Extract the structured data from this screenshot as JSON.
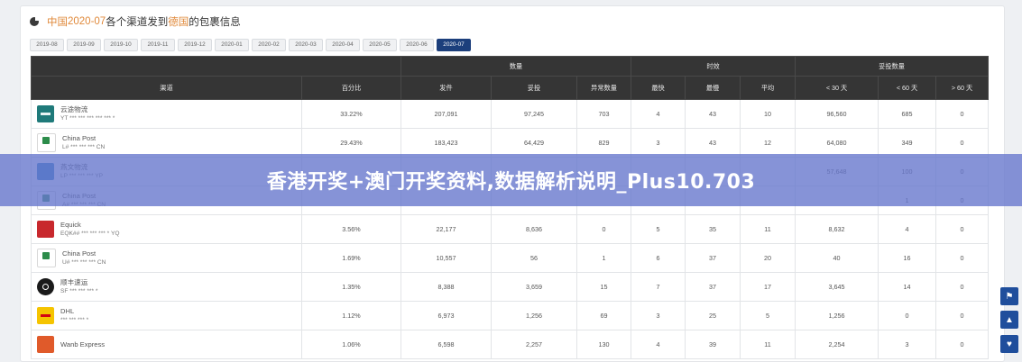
{
  "header": {
    "prefix": "中国",
    "month": "2020-07",
    "middle": "各个渠道发到",
    "country": "德国",
    "suffix": "的包裹信息"
  },
  "months": [
    "2019-08",
    "2019-09",
    "2019-10",
    "2019-11",
    "2019-12",
    "2020-01",
    "2020-02",
    "2020-03",
    "2020-04",
    "2020-05",
    "2020-06",
    "2020-07"
  ],
  "table": {
    "group_headers": {
      "quantity": "数量",
      "timeliness": "时效",
      "delivery": "妥投数量"
    },
    "columns": [
      "渠道",
      "百分比",
      "发件",
      "妥投",
      "异常数量",
      "最快",
      "最慢",
      "平均",
      "< 30 天",
      "< 60 天",
      "> 60 天"
    ],
    "rows": [
      {
        "logo": "yt",
        "name": "云途物流",
        "code": "YT *** *** *** *** *** *",
        "cells": [
          "33.22%",
          "207,091",
          "97,245",
          "703",
          "4",
          "43",
          "10",
          "96,560",
          "685",
          "0"
        ]
      },
      {
        "logo": "cn",
        "name": "China Post",
        "code": "L# *** *** *** CN",
        "cells": [
          "29.43%",
          "183,423",
          "64,429",
          "829",
          "3",
          "43",
          "12",
          "64,080",
          "349",
          "0"
        ]
      },
      {
        "logo": "yw",
        "name": "燕文物流",
        "code": "LP *** *** *** YP",
        "cells": [
          "",
          "",
          "",
          "",
          "",
          "",
          "",
          "57,648",
          "100",
          "0"
        ]
      },
      {
        "logo": "cn",
        "name": "China Post",
        "code": "A# *** *** *** CN",
        "cells": [
          "",
          "",
          "",
          "",
          "",
          "",
          "",
          "",
          "1",
          "0"
        ]
      },
      {
        "logo": "eq",
        "name": "Equick",
        "code": "EQK## *** *** *** * YQ",
        "cells": [
          "3.56%",
          "22,177",
          "8,636",
          "0",
          "5",
          "35",
          "11",
          "8,632",
          "4",
          "0"
        ]
      },
      {
        "logo": "cn",
        "name": "China Post",
        "code": "U# *** *** *** CN",
        "cells": [
          "1.69%",
          "10,557",
          "56",
          "1",
          "6",
          "37",
          "20",
          "40",
          "16",
          "0"
        ]
      },
      {
        "logo": "sf",
        "name": "顺丰速运",
        "code": "SF *** *** *** *",
        "cells": [
          "1.35%",
          "8,388",
          "3,659",
          "15",
          "7",
          "37",
          "17",
          "3,645",
          "14",
          "0"
        ]
      },
      {
        "logo": "dhl",
        "name": "DHL",
        "code": "*** *** *** *",
        "cells": [
          "1.12%",
          "6,973",
          "1,256",
          "69",
          "3",
          "25",
          "5",
          "1,256",
          "0",
          "0"
        ]
      },
      {
        "logo": "wb",
        "name": "Wanb Express",
        "code": "",
        "cells": [
          "1.06%",
          "6,598",
          "2,257",
          "130",
          "4",
          "39",
          "11",
          "2,254",
          "3",
          "0"
        ]
      }
    ]
  },
  "banner": {
    "text": "香港开奖+澳门开奖资料,数据解析说明_Plus10.703"
  },
  "side_icons": [
    "pin-icon",
    "chevron-up-icon",
    "heart-icon",
    "chevron-down-icon"
  ],
  "colors": {
    "accent": "#1c3f7c",
    "banner": "#6878cd",
    "header_dark": "#353535",
    "highlight": "#e0893a"
  }
}
